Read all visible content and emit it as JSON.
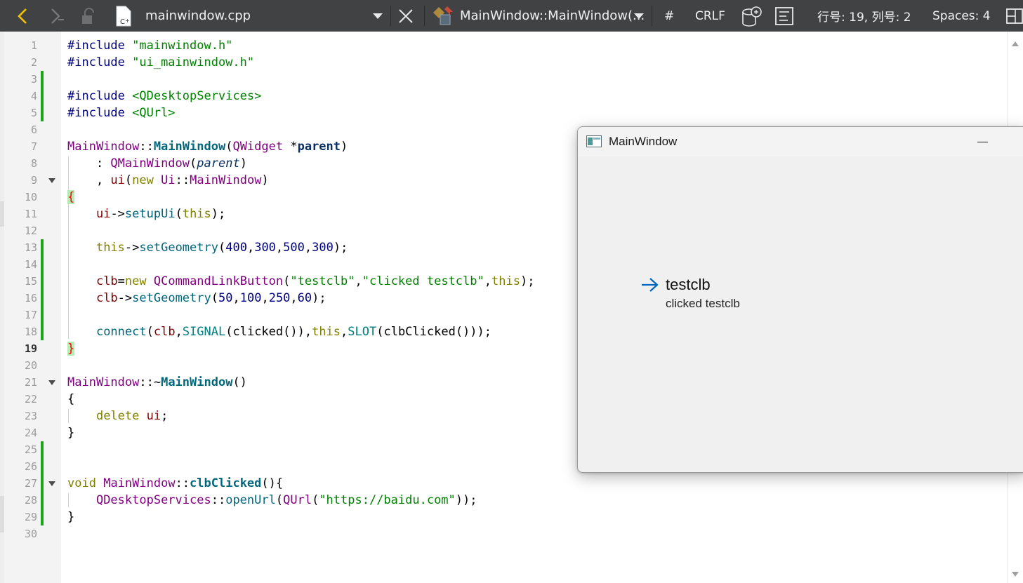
{
  "toolbar": {
    "file_name": "mainwindow.cpp",
    "symbol": "MainWindow::MainWindow(...",
    "hash_label": "#",
    "line_ending": "CRLF",
    "cursor_position": "行号: 19, 列号: 2",
    "indentation": "Spaces: 4"
  },
  "editor": {
    "current_line": 19,
    "line_numbers": [
      "1",
      "2",
      "3",
      "4",
      "5",
      "6",
      "7",
      "8",
      "9",
      "10",
      "11",
      "12",
      "13",
      "14",
      "15",
      "16",
      "17",
      "18",
      "19",
      "20",
      "21",
      "22",
      "23",
      "24",
      "25",
      "26",
      "27",
      "28",
      "29",
      "30"
    ],
    "folded_lines": [
      9,
      21,
      27
    ],
    "changed_line_ranges": [
      [
        3,
        5
      ],
      [
        13,
        18
      ],
      [
        25,
        29
      ]
    ],
    "lines": [
      [
        {
          "t": "#include ",
          "c": "pp"
        },
        {
          "t": "\"mainwindow.h\"",
          "c": "str"
        }
      ],
      [
        {
          "t": "#include ",
          "c": "pp"
        },
        {
          "t": "\"ui_mainwindow.h\"",
          "c": "str"
        }
      ],
      [],
      [
        {
          "t": "#include ",
          "c": "pp"
        },
        {
          "t": "<QDesktopServices>",
          "c": "str"
        }
      ],
      [
        {
          "t": "#include ",
          "c": "pp"
        },
        {
          "t": "<QUrl>",
          "c": "str"
        }
      ],
      [],
      [
        {
          "t": "MainWindow",
          "c": "type"
        },
        {
          "t": "::",
          "c": "plain"
        },
        {
          "t": "MainWindow",
          "c": "funcbold"
        },
        {
          "t": "(",
          "c": "plain"
        },
        {
          "t": "QWidget",
          "c": "type"
        },
        {
          "t": " *",
          "c": "plain"
        },
        {
          "t": "parent",
          "c": "parambold"
        },
        {
          "t": ")",
          "c": "plain"
        }
      ],
      [
        {
          "t": "    : ",
          "c": "plain"
        },
        {
          "t": "QMainWindow",
          "c": "type"
        },
        {
          "t": "(",
          "c": "plain"
        },
        {
          "t": "parent",
          "c": "paramital"
        },
        {
          "t": ")",
          "c": "plain"
        }
      ],
      [
        {
          "t": "    , ",
          "c": "plain"
        },
        {
          "t": "ui",
          "c": "member"
        },
        {
          "t": "(",
          "c": "plain"
        },
        {
          "t": "new",
          "c": "kw"
        },
        {
          "t": " ",
          "c": "plain"
        },
        {
          "t": "Ui",
          "c": "type"
        },
        {
          "t": "::",
          "c": "plain"
        },
        {
          "t": "MainWindow",
          "c": "type"
        },
        {
          "t": ")",
          "c": "plain"
        }
      ],
      [
        {
          "t": "{",
          "c": "bracehl"
        }
      ],
      [
        {
          "t": "    ",
          "c": "plain"
        },
        {
          "t": "ui",
          "c": "member"
        },
        {
          "t": "->",
          "c": "plain"
        },
        {
          "t": "setupUi",
          "c": "func"
        },
        {
          "t": "(",
          "c": "plain"
        },
        {
          "t": "this",
          "c": "kw"
        },
        {
          "t": ");",
          "c": "plain"
        }
      ],
      [],
      [
        {
          "t": "    ",
          "c": "plain"
        },
        {
          "t": "this",
          "c": "kw"
        },
        {
          "t": "->",
          "c": "plain"
        },
        {
          "t": "setGeometry",
          "c": "func"
        },
        {
          "t": "(",
          "c": "plain"
        },
        {
          "t": "400",
          "c": "num"
        },
        {
          "t": ",",
          "c": "plain"
        },
        {
          "t": "300",
          "c": "num"
        },
        {
          "t": ",",
          "c": "plain"
        },
        {
          "t": "500",
          "c": "num"
        },
        {
          "t": ",",
          "c": "plain"
        },
        {
          "t": "300",
          "c": "num"
        },
        {
          "t": ");",
          "c": "plain"
        }
      ],
      [],
      [
        {
          "t": "    ",
          "c": "plain"
        },
        {
          "t": "clb",
          "c": "member"
        },
        {
          "t": "=",
          "c": "plain"
        },
        {
          "t": "new",
          "c": "kw"
        },
        {
          "t": " ",
          "c": "plain"
        },
        {
          "t": "QCommandLinkButton",
          "c": "type"
        },
        {
          "t": "(",
          "c": "plain"
        },
        {
          "t": "\"testclb\"",
          "c": "str"
        },
        {
          "t": ",",
          "c": "plain"
        },
        {
          "t": "\"clicked testclb\"",
          "c": "str"
        },
        {
          "t": ",",
          "c": "plain"
        },
        {
          "t": "this",
          "c": "kw"
        },
        {
          "t": ");",
          "c": "plain"
        }
      ],
      [
        {
          "t": "    ",
          "c": "plain"
        },
        {
          "t": "clb",
          "c": "member"
        },
        {
          "t": "->",
          "c": "plain"
        },
        {
          "t": "setGeometry",
          "c": "func"
        },
        {
          "t": "(",
          "c": "plain"
        },
        {
          "t": "50",
          "c": "num"
        },
        {
          "t": ",",
          "c": "plain"
        },
        {
          "t": "100",
          "c": "num"
        },
        {
          "t": ",",
          "c": "plain"
        },
        {
          "t": "250",
          "c": "num"
        },
        {
          "t": ",",
          "c": "plain"
        },
        {
          "t": "60",
          "c": "num"
        },
        {
          "t": ");",
          "c": "plain"
        }
      ],
      [],
      [
        {
          "t": "    ",
          "c": "plain"
        },
        {
          "t": "connect",
          "c": "func"
        },
        {
          "t": "(",
          "c": "plain"
        },
        {
          "t": "clb",
          "c": "member"
        },
        {
          "t": ",",
          "c": "plain"
        },
        {
          "t": "SIGNAL",
          "c": "macro"
        },
        {
          "t": "(clicked()),",
          "c": "plain"
        },
        {
          "t": "this",
          "c": "kw"
        },
        {
          "t": ",",
          "c": "plain"
        },
        {
          "t": "SLOT",
          "c": "macro"
        },
        {
          "t": "(clbClicked()));",
          "c": "plain"
        }
      ],
      [
        {
          "t": "}",
          "c": "bracehl"
        }
      ],
      [],
      [
        {
          "t": "MainWindow",
          "c": "type"
        },
        {
          "t": "::~",
          "c": "plain"
        },
        {
          "t": "MainWindow",
          "c": "funcbold"
        },
        {
          "t": "()",
          "c": "plain"
        }
      ],
      [
        {
          "t": "{",
          "c": "plain"
        }
      ],
      [
        {
          "t": "    ",
          "c": "plain"
        },
        {
          "t": "delete",
          "c": "kw"
        },
        {
          "t": " ",
          "c": "plain"
        },
        {
          "t": "ui",
          "c": "member"
        },
        {
          "t": ";",
          "c": "plain"
        }
      ],
      [
        {
          "t": "}",
          "c": "plain"
        }
      ],
      [],
      [],
      [
        {
          "t": "void",
          "c": "kw"
        },
        {
          "t": " ",
          "c": "plain"
        },
        {
          "t": "MainWindow",
          "c": "type"
        },
        {
          "t": "::",
          "c": "plain"
        },
        {
          "t": "clbClicked",
          "c": "funcbold"
        },
        {
          "t": "(){",
          "c": "plain"
        }
      ],
      [
        {
          "t": "    ",
          "c": "plain"
        },
        {
          "t": "QDesktopServices",
          "c": "type"
        },
        {
          "t": "::",
          "c": "plain"
        },
        {
          "t": "openUrl",
          "c": "func"
        },
        {
          "t": "(",
          "c": "plain"
        },
        {
          "t": "QUrl",
          "c": "type"
        },
        {
          "t": "(",
          "c": "plain"
        },
        {
          "t": "\"https://baidu.com\"",
          "c": "str"
        },
        {
          "t": "));",
          "c": "plain"
        }
      ],
      [
        {
          "t": "}",
          "c": "plain"
        }
      ],
      []
    ]
  },
  "syntax_colors": {
    "pp": "#000080",
    "str": "#008000",
    "type": "#800080",
    "func": "#00677c",
    "funcbold": "#00677c",
    "member": "#800000",
    "kw": "#808000",
    "num": "#000080",
    "macro": "#008080",
    "plain": "#000000",
    "parambold": "#092e64",
    "paramital": "#092e64",
    "bracehl": "#ff0000"
  },
  "app_window": {
    "title": "MainWindow",
    "minimize_glyph": "—",
    "command_link": {
      "title": "testclb",
      "description": "clicked testclb",
      "arrow_color": "#0067c0"
    }
  }
}
